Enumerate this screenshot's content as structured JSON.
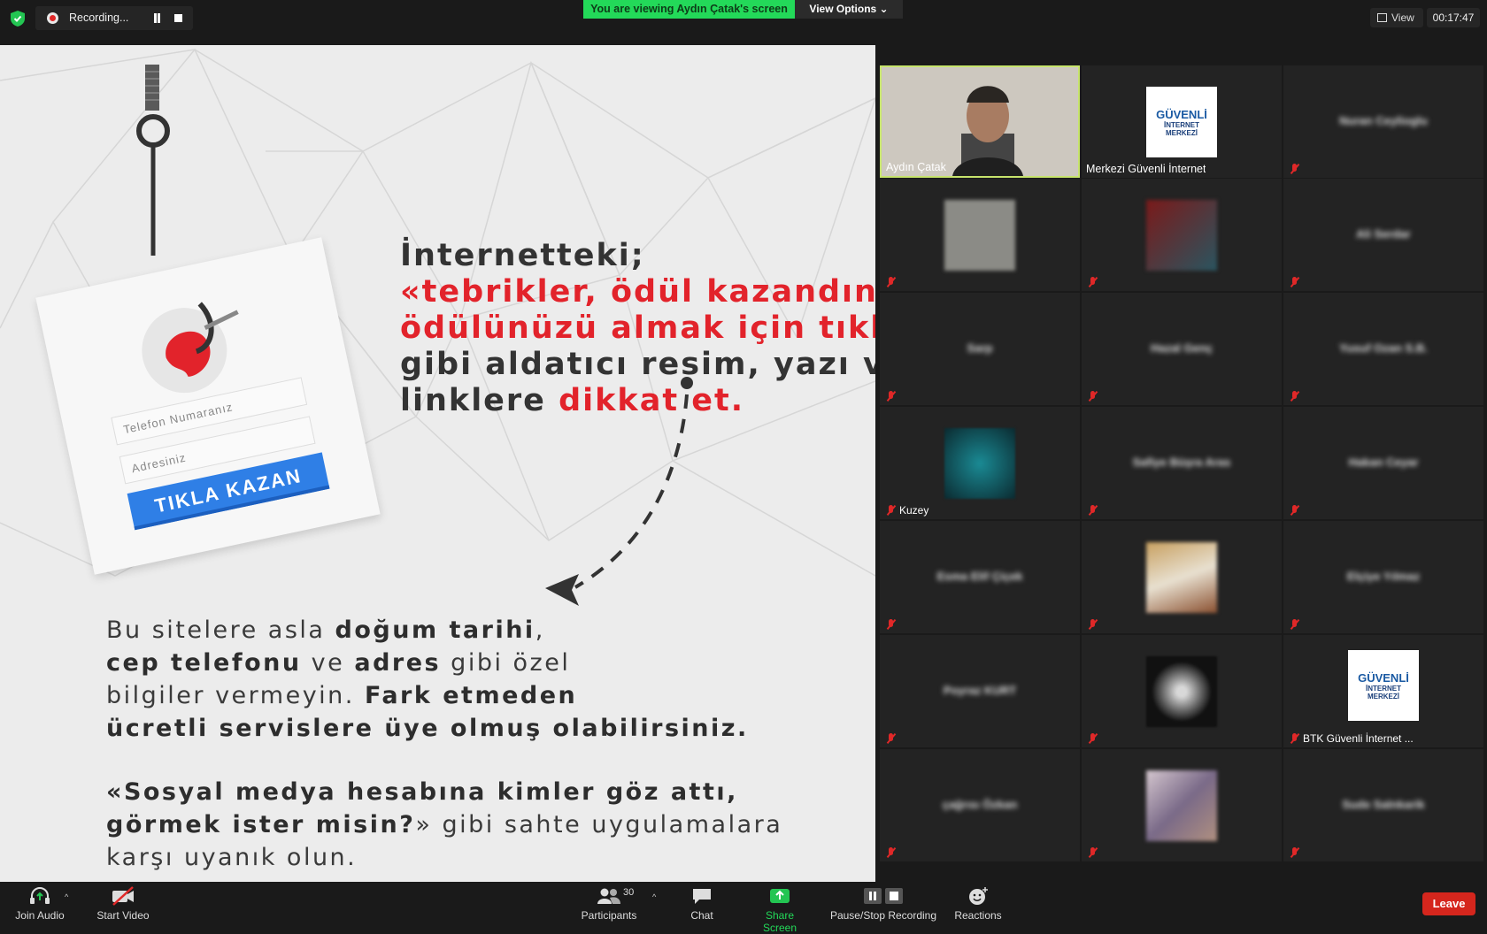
{
  "topbar": {
    "recording_label": "Recording...",
    "viewing_banner": "You are viewing Aydın Çatak's screen",
    "view_options_label": "View Options ⌄",
    "view_label": "View",
    "timer": "00:17:47"
  },
  "slide": {
    "headline_line1": "İnternetteki;",
    "headline_line2": "«tebrikler, ödül kazandınız.",
    "headline_line3": "ödülünüzü almak için tıklayın",
    "headline_line4": "gibi aldatıcı resim, yazı ve",
    "headline_line5a": "linklere ",
    "headline_line5b": "dikkat et.",
    "card_field1": "Telefon Numaranız",
    "card_field2": "Adresiniz",
    "card_button": "TIKLA KAZAN",
    "p1_l1a": "Bu sitelere asla ",
    "p1_l1b": "doğum tarihi",
    "p1_l1c": ",",
    "p1_l2a": "cep telefonu",
    "p1_l2b": " ve ",
    "p1_l2c": "adres",
    "p1_l2d": " gibi özel",
    "p1_l3a": "bilgiler vermeyin. ",
    "p1_l3b": "Fark etmeden",
    "p1_l4": "ücretli servislere üye olmuş olabilirsiniz.",
    "p2_l1": "«Sosyal medya hesabına kimler göz attı,",
    "p2_l2a": "görmek ister misin?",
    "p2_l2b": "» gibi sahte uygulamalara",
    "p2_l3": "karşı uyanık olun."
  },
  "gallery": {
    "tiles": [
      {
        "name": "Aydın Çatak"
      },
      {
        "name": "Merkezi Güvenli İnternet"
      },
      {
        "name": "Nuran Ceylioglu"
      },
      {
        "name": "Ali Serdar"
      },
      {
        "name": "Sarp"
      },
      {
        "name": "Hazal Genç"
      },
      {
        "name": "Yusuf Ozan S.B."
      },
      {
        "name": "Kuzey"
      },
      {
        "name": "Safiye Büşra Aras"
      },
      {
        "name": "Hakan Ceyar"
      },
      {
        "name": "Esma Elif Çiçek"
      },
      {
        "name": "Elçiye Yılmaz"
      },
      {
        "name": "Poyraz KURT"
      },
      {
        "name": "BTK Güvenli İnternet ..."
      },
      {
        "name": "çağrısı Özkan"
      },
      {
        "name": "Sude Salnkarik"
      }
    ],
    "logo_line1": "GÜVENLİ",
    "logo_line2": "İNTERNET",
    "logo_line3": "MERKEZİ"
  },
  "toolbar": {
    "join_audio": "Join Audio",
    "start_video": "Start Video",
    "participants": "Participants",
    "participants_count": "30",
    "chat": "Chat",
    "share_screen": "Share Screen",
    "pause_stop": "Pause/Stop Recording",
    "reactions": "Reactions",
    "leave": "Leave"
  },
  "colors": {
    "banner_green": "#23d959",
    "leave_red": "#d5261d",
    "slide_red": "#e2232b",
    "share_green": "#23d959"
  }
}
